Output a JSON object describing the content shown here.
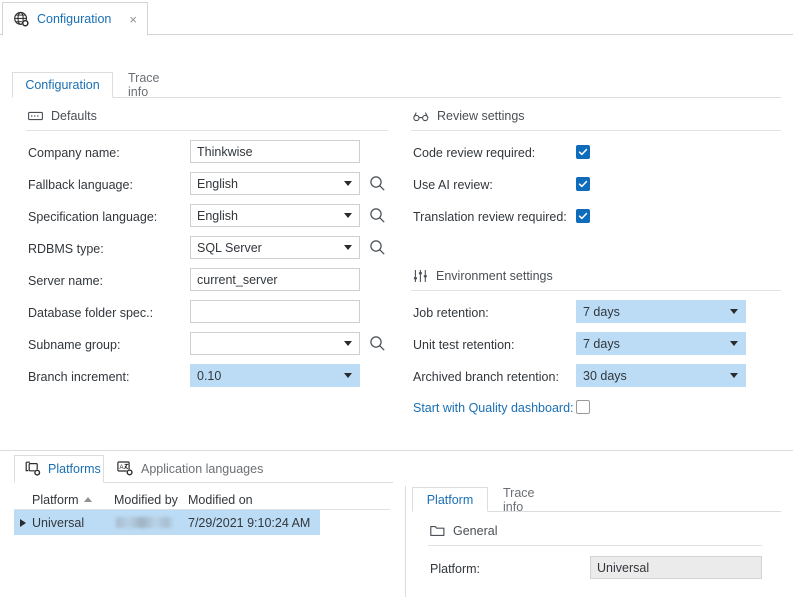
{
  "window_tab": {
    "icon": "globe-gear-icon",
    "title": "Configuration",
    "close_label": "×"
  },
  "inner_tabs": [
    {
      "label": "Configuration",
      "active": true
    },
    {
      "label": "Trace info",
      "active": false
    }
  ],
  "defaults_section": {
    "icon": "form-input-icon",
    "title": "Defaults",
    "fields": [
      {
        "label": "Company name:",
        "value": "Thinkwise",
        "type": "text",
        "highlighted": false,
        "lookup": false
      },
      {
        "label": "Fallback language:",
        "value": "English",
        "type": "dropdown",
        "highlighted": false,
        "lookup": true
      },
      {
        "label": "Specification language:",
        "value": "English",
        "type": "dropdown",
        "highlighted": false,
        "lookup": true
      },
      {
        "label": "RDBMS type:",
        "value": "SQL Server",
        "type": "dropdown",
        "highlighted": false,
        "lookup": true
      },
      {
        "label": "Server name:",
        "value": "current_server",
        "type": "text",
        "highlighted": false,
        "lookup": false
      },
      {
        "label": "Database folder spec.:",
        "value": "",
        "type": "text",
        "highlighted": false,
        "lookup": false
      },
      {
        "label": "Subname group:",
        "value": "",
        "type": "dropdown",
        "highlighted": false,
        "lookup": true
      },
      {
        "label": "Branch increment:",
        "value": "0.10",
        "type": "dropdown",
        "highlighted": true,
        "lookup": false
      }
    ]
  },
  "review_section": {
    "icon": "glasses-icon",
    "title": "Review settings",
    "fields": [
      {
        "label": "Code review required:",
        "checked": true
      },
      {
        "label": "Use AI review:",
        "checked": true
      },
      {
        "label": "Translation review required:",
        "checked": true
      }
    ]
  },
  "environment_section": {
    "icon": "sliders-icon",
    "title": "Environment settings",
    "fields": [
      {
        "label": "Job retention:",
        "value": "7 days",
        "type": "dropdown",
        "highlighted": true
      },
      {
        "label": "Unit test retention:",
        "value": "7 days",
        "type": "dropdown",
        "highlighted": true
      },
      {
        "label": "Archived branch retention:",
        "value": "30 days",
        "type": "dropdown",
        "highlighted": true
      }
    ],
    "checkbox_field": {
      "label": "Start with Quality dashboard:",
      "checked": false,
      "label_is_link": true
    }
  },
  "bottom_tabs": [
    {
      "label": "Platforms",
      "icon": "platforms-gear-icon",
      "active": true
    },
    {
      "label": "Application languages",
      "icon": "translate-gear-icon",
      "active": false
    }
  ],
  "grid": {
    "columns": [
      {
        "label": "Platform",
        "sort": "asc"
      },
      {
        "label": "Modified by",
        "sort": null
      },
      {
        "label": "Modified on",
        "sort": null
      }
    ],
    "rows": [
      {
        "platform": "Universal",
        "modified_by": "",
        "modified_by_redacted": true,
        "modified_on": "7/29/2021 9:10:24 AM",
        "selected": true
      }
    ]
  },
  "detail_panel": {
    "tabs": [
      {
        "label": "Platform",
        "active": true
      },
      {
        "label": "Trace info",
        "active": false
      }
    ],
    "section": {
      "icon": "folder-icon",
      "title": "General"
    },
    "fields": [
      {
        "label": "Platform:",
        "value": "Universal",
        "readonly": true
      }
    ]
  },
  "colors": {
    "accent_link": "#1a6fb4",
    "checkbox_on": "#0f6cbd",
    "row_selected": "#bcdcf5",
    "field_highlight": "#bcdcf5",
    "readonly_fill": "#ebebeb",
    "border": "#cfcfcf"
  }
}
